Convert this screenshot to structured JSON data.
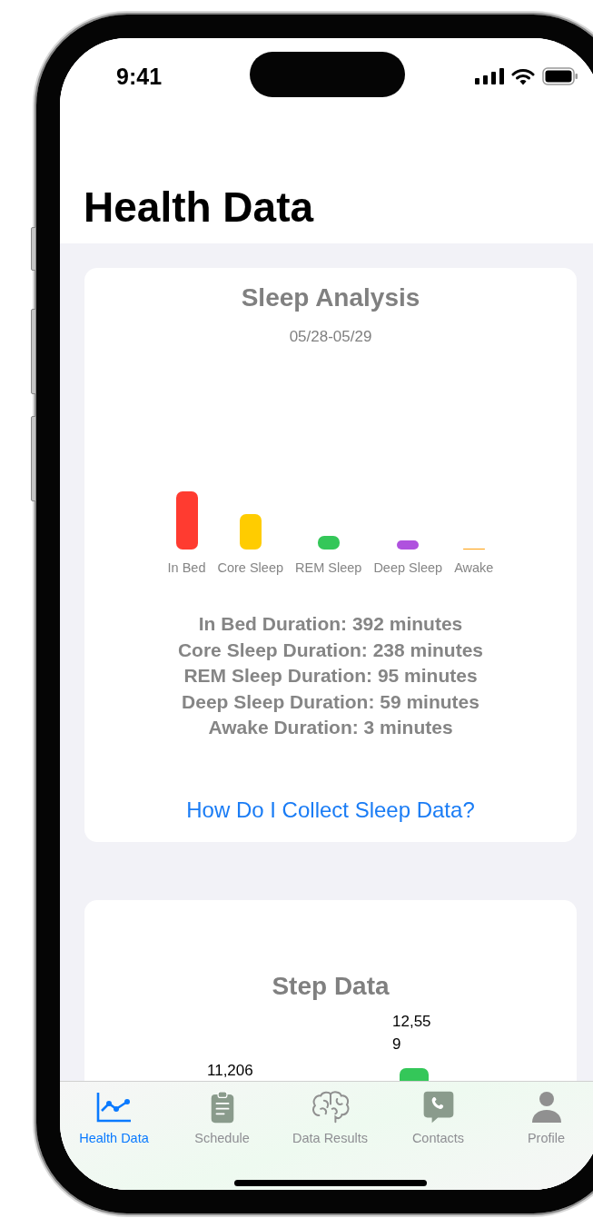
{
  "status_bar": {
    "time": "9:41"
  },
  "title": "Health Data",
  "sleep_card": {
    "title": "Sleep Analysis",
    "date_range": "05/28-05/29",
    "bars": [
      {
        "label": "In Bed",
        "color": "#ff3b30"
      },
      {
        "label": "Core Sleep",
        "color": "#ffcc00"
      },
      {
        "label": "REM Sleep",
        "color": "#34c759"
      },
      {
        "label": "Deep Sleep",
        "color": "#af52de"
      },
      {
        "label": "Awake",
        "color": "#ff9f0a"
      }
    ],
    "durations": [
      "In Bed Duration: 392 minutes",
      "Core Sleep Duration: 238 minutes",
      "REM Sleep Duration: 95 minutes",
      "Deep Sleep Duration: 59 minutes",
      "Awake Duration: 3 minutes"
    ],
    "link": "How Do I Collect Sleep Data?"
  },
  "step_card": {
    "title": "Step Data",
    "value_labels": [
      "11,206",
      "12,559"
    ]
  },
  "tabs": [
    {
      "label": "Health Data",
      "selected": true
    },
    {
      "label": "Schedule",
      "selected": false
    },
    {
      "label": "Data Results",
      "selected": false
    },
    {
      "label": "Contacts",
      "selected": false
    },
    {
      "label": "Profile",
      "selected": false
    }
  ]
}
